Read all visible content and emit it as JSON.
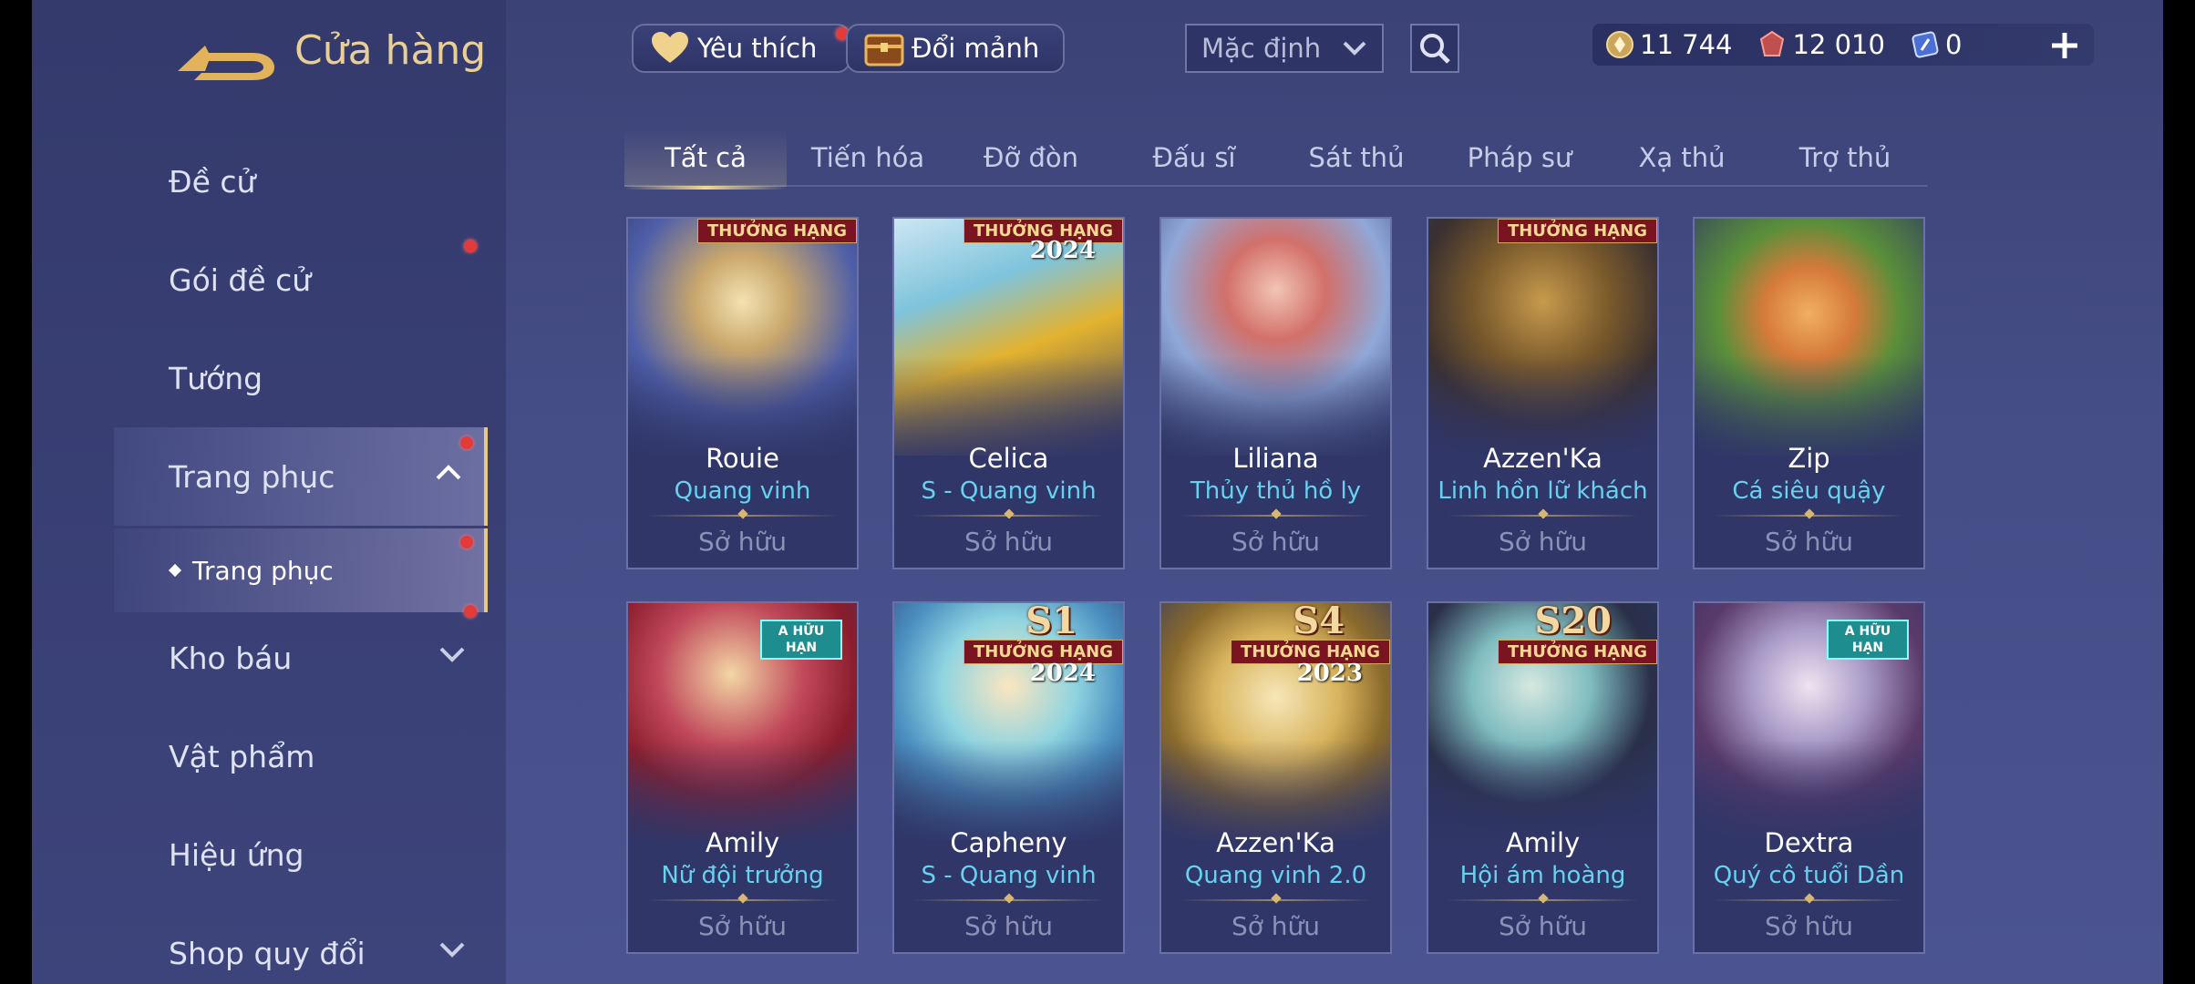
{
  "header": {
    "title": "Cửa hàng",
    "favorite_label": "Yêu thích",
    "shard_label": "Đổi mảnh",
    "sort_value": "Mặc định"
  },
  "currencies": [
    {
      "icon": "coin-icon",
      "value": "11 744"
    },
    {
      "icon": "gem-icon",
      "value": "12 010"
    },
    {
      "icon": "voucher-icon",
      "value": "0"
    }
  ],
  "sidebar": {
    "items": [
      {
        "label": "Đề cử"
      },
      {
        "label": "Gói đề cử"
      },
      {
        "label": "Tướng"
      },
      {
        "label": "Trang phục"
      },
      {
        "label": "Kho báu"
      },
      {
        "label": "Vật phẩm"
      },
      {
        "label": "Hiệu ứng"
      },
      {
        "label": "Shop quy đổi"
      }
    ],
    "sub_item": "Trang phục"
  },
  "tabs": [
    "Tất cả",
    "Tiến hóa",
    "Đỡ đòn",
    "Đấu sĩ",
    "Sát thủ",
    "Pháp sư",
    "Xạ thủ",
    "Trợ thủ"
  ],
  "cards": [
    {
      "name": "Rouie",
      "skin": "Quang vinh",
      "status": "Sở hữu",
      "badge": "THƯỞNG HẠNG"
    },
    {
      "name": "Celica",
      "skin": "S - Quang vinh",
      "status": "Sở hữu",
      "badge": "THƯỞNG HẠNG",
      "year": "2024"
    },
    {
      "name": "Liliana",
      "skin": "Thủy thủ hồ ly",
      "status": "Sở hữu"
    },
    {
      "name": "Azzen'Ka",
      "skin": "Linh hồn lữ khách",
      "status": "Sở hữu",
      "badge": "THƯỞNG HẠNG"
    },
    {
      "name": "Zip",
      "skin": "Cá siêu quậy",
      "status": "Sở hữu"
    },
    {
      "name": "Amily",
      "skin": "Nữ đội trưởng",
      "status": "Sở hữu",
      "limited": "A HỮU HẠN"
    },
    {
      "name": "Capheny",
      "skin": "S - Quang vinh",
      "status": "Sở hữu",
      "season": "S1",
      "badge": "THƯỞNG HẠNG",
      "year": "2024"
    },
    {
      "name": "Azzen'Ka",
      "skin": "Quang vinh 2.0",
      "status": "Sở hữu",
      "season": "S4",
      "badge": "THƯỞNG HẠNG",
      "year": "2023"
    },
    {
      "name": "Amily",
      "skin": "Hội ám hoàng",
      "status": "Sở hữu",
      "season": "S20",
      "badge": "THƯỞNG HẠNG"
    },
    {
      "name": "Dextra",
      "skin": "Quý cô tuổi Dần",
      "status": "Sở hữu",
      "limited": "A HỮU HẠN"
    }
  ],
  "colors": {
    "accent_gold": "#e7c980",
    "skin_name": "#66d2f0",
    "background": "#454d86"
  }
}
